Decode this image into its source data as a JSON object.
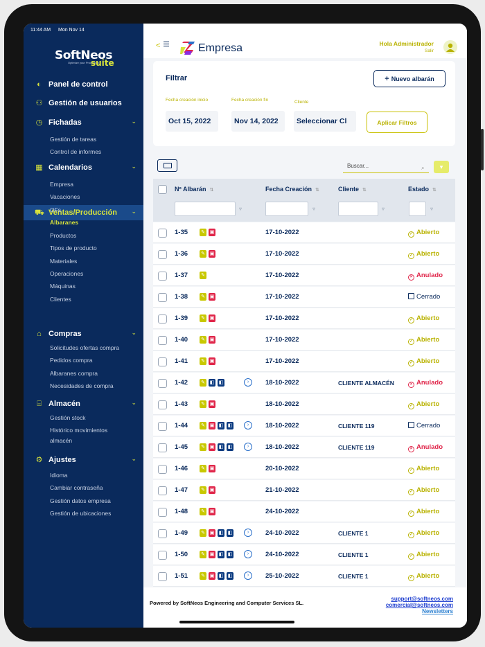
{
  "status_bar": {
    "time": "11:44 AM",
    "date": "Mon Nov 14"
  },
  "logo": {
    "text": "SoftNeos",
    "suite": "suite",
    "tagline": "Optimize your Production"
  },
  "sidebar": {
    "items": [
      {
        "label": "Panel de control",
        "icon": "speedometer-icon"
      },
      {
        "label": "Gestión de usuarios",
        "icon": "users-icon"
      },
      {
        "label": "Fichadas",
        "icon": "clock-icon",
        "expanded": true,
        "children": [
          "Gestión de tareas",
          "Control de informes"
        ]
      },
      {
        "label": "Calendarios",
        "icon": "calendar-icon",
        "expanded": true,
        "children": [
          "Empresa",
          "Vacaciones"
        ]
      },
      {
        "label": "Ventas/Producción",
        "icon": "shopping-cart-icon",
        "active": true,
        "expanded": true,
        "children": [
          "OFs",
          "Albaranes",
          "Productos",
          "Tipos de producto",
          "Materiales",
          "Operaciones",
          "Máquinas",
          "Clientes"
        ],
        "active_child": "Albaranes"
      },
      {
        "label": "Compras",
        "icon": "basket-icon",
        "expanded": true,
        "children": [
          "Solicitudes ofertas compra",
          "Pedidos compra",
          "Albaranes compra",
          "Necesidades de compra"
        ]
      },
      {
        "label": "Almacén",
        "icon": "warehouse-icon",
        "expanded": true,
        "children": [
          "Gestión stock",
          "Histórico movimientos",
          "almacén"
        ]
      },
      {
        "label": "Ajustes",
        "icon": "gear-icon",
        "expanded": true,
        "children": [
          "Idioma",
          "Cambiar contraseña",
          "Gestión datos empresa",
          "Gestión de ubicaciones"
        ]
      }
    ]
  },
  "header": {
    "brand": "Empresa",
    "greeting": "Hola Administrador",
    "logout": "Salir"
  },
  "filter": {
    "title": "Filtrar",
    "new_button": "Nuevo albarán",
    "start_label": "Fecha creación inicio",
    "start_value": "Oct 15, 2022",
    "end_label": "Fecha creación fin",
    "end_value": "Nov 14, 2022",
    "client_label": "Cliente",
    "client_value": "Seleccionar Cl",
    "apply_button": "Aplicar Filtros"
  },
  "search": {
    "placeholder": "Buscar..."
  },
  "table": {
    "headers": {
      "number": "Nº Albarán",
      "date": "Fecha Creación",
      "client": "Cliente",
      "status": "Estado"
    },
    "rows": [
      {
        "number": "1-35",
        "badges": [
          "y",
          "r"
        ],
        "arrow": false,
        "date": "17-10-2022",
        "client": "",
        "status": "Abierto"
      },
      {
        "number": "1-36",
        "badges": [
          "y",
          "r"
        ],
        "arrow": false,
        "date": "17-10-2022",
        "client": "",
        "status": "Abierto"
      },
      {
        "number": "1-37",
        "badges": [
          "y"
        ],
        "arrow": false,
        "date": "17-10-2022",
        "client": "",
        "status": "Anulado"
      },
      {
        "number": "1-38",
        "badges": [
          "y",
          "r"
        ],
        "arrow": false,
        "date": "17-10-2022",
        "client": "",
        "status": "Cerrado"
      },
      {
        "number": "1-39",
        "badges": [
          "y",
          "r"
        ],
        "arrow": false,
        "date": "17-10-2022",
        "client": "",
        "status": "Abierto"
      },
      {
        "number": "1-40",
        "badges": [
          "y",
          "r"
        ],
        "arrow": false,
        "date": "17-10-2022",
        "client": "",
        "status": "Abierto"
      },
      {
        "number": "1-41",
        "badges": [
          "y",
          "r"
        ],
        "arrow": false,
        "date": "17-10-2022",
        "client": "",
        "status": "Abierto"
      },
      {
        "number": "1-42",
        "badges": [
          "y",
          "b",
          "b"
        ],
        "arrow": true,
        "date": "18-10-2022",
        "client": "CLIENTE ALMACÉN",
        "status": "Anulado"
      },
      {
        "number": "1-43",
        "badges": [
          "y",
          "r"
        ],
        "arrow": false,
        "date": "18-10-2022",
        "client": "",
        "status": "Abierto"
      },
      {
        "number": "1-44",
        "badges": [
          "y",
          "r",
          "b",
          "b"
        ],
        "arrow": true,
        "date": "18-10-2022",
        "client": "CLIENTE 119",
        "status": "Cerrado"
      },
      {
        "number": "1-45",
        "badges": [
          "y",
          "r",
          "b",
          "b"
        ],
        "arrow": true,
        "date": "18-10-2022",
        "client": "CLIENTE 119",
        "status": "Anulado"
      },
      {
        "number": "1-46",
        "badges": [
          "y",
          "r"
        ],
        "arrow": false,
        "date": "20-10-2022",
        "client": "",
        "status": "Abierto"
      },
      {
        "number": "1-47",
        "badges": [
          "y",
          "r"
        ],
        "arrow": false,
        "date": "21-10-2022",
        "client": "",
        "status": "Abierto"
      },
      {
        "number": "1-48",
        "badges": [
          "y",
          "r"
        ],
        "arrow": false,
        "date": "24-10-2022",
        "client": "",
        "status": "Abierto"
      },
      {
        "number": "1-49",
        "badges": [
          "y",
          "r",
          "b",
          "b"
        ],
        "arrow": true,
        "date": "24-10-2022",
        "client": "CLIENTE 1",
        "status": "Abierto"
      },
      {
        "number": "1-50",
        "badges": [
          "y",
          "r",
          "b",
          "b"
        ],
        "arrow": true,
        "date": "24-10-2022",
        "client": "CLIENTE 1",
        "status": "Abierto"
      },
      {
        "number": "1-51",
        "badges": [
          "y",
          "r",
          "b",
          "b"
        ],
        "arrow": true,
        "date": "25-10-2022",
        "client": "CLIENTE 1",
        "status": "Abierto"
      }
    ]
  },
  "footer": {
    "powered": "Powered by SoftNeos Engineering and Computer Services SL.",
    "support": "support@softneos.com",
    "commercial": "comercial@softneos.com",
    "newsletters": "Newsletters"
  },
  "colors": {
    "sidebar": "#0a2a5c",
    "accent": "#d6e23d",
    "danger": "#e0264a"
  }
}
